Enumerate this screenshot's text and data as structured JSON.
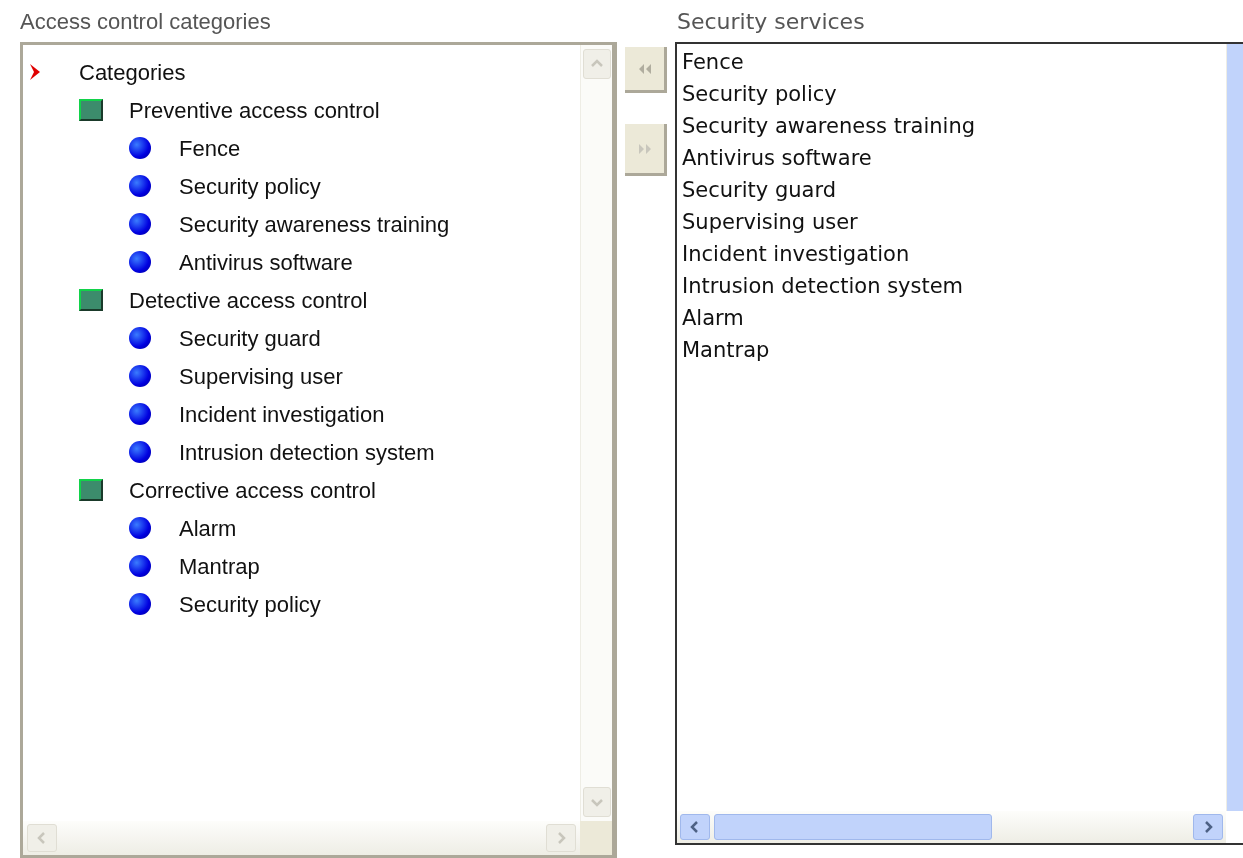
{
  "tree_panel": {
    "label": "Access control categories",
    "tree": [
      {
        "kind": "root",
        "label": "Categories",
        "children": [
          {
            "kind": "group",
            "label": "Preventive access control",
            "children": [
              {
                "kind": "leaf",
                "label": "Fence"
              },
              {
                "kind": "leaf",
                "label": "Security policy"
              },
              {
                "kind": "leaf",
                "label": "Security awareness training"
              },
              {
                "kind": "leaf",
                "label": "Antivirus software"
              }
            ]
          },
          {
            "kind": "group",
            "label": "Detective access control",
            "children": [
              {
                "kind": "leaf",
                "label": "Security guard"
              },
              {
                "kind": "leaf",
                "label": "Supervising user"
              },
              {
                "kind": "leaf",
                "label": "Incident investigation"
              },
              {
                "kind": "leaf",
                "label": "Intrusion detection system"
              }
            ]
          },
          {
            "kind": "group",
            "label": "Corrective access control",
            "children": [
              {
                "kind": "leaf",
                "label": "Alarm"
              },
              {
                "kind": "leaf",
                "label": "Mantrap"
              },
              {
                "kind": "leaf",
                "label": "Security policy"
              }
            ]
          }
        ]
      }
    ]
  },
  "list_panel": {
    "label": "Security services",
    "items": [
      "Fence",
      "Security policy",
      "Security awareness training",
      "Antivirus software",
      "Security guard",
      "Supervising user",
      "Incident investigation",
      "Intrusion detection system",
      "Alarm",
      "Mantrap"
    ]
  }
}
